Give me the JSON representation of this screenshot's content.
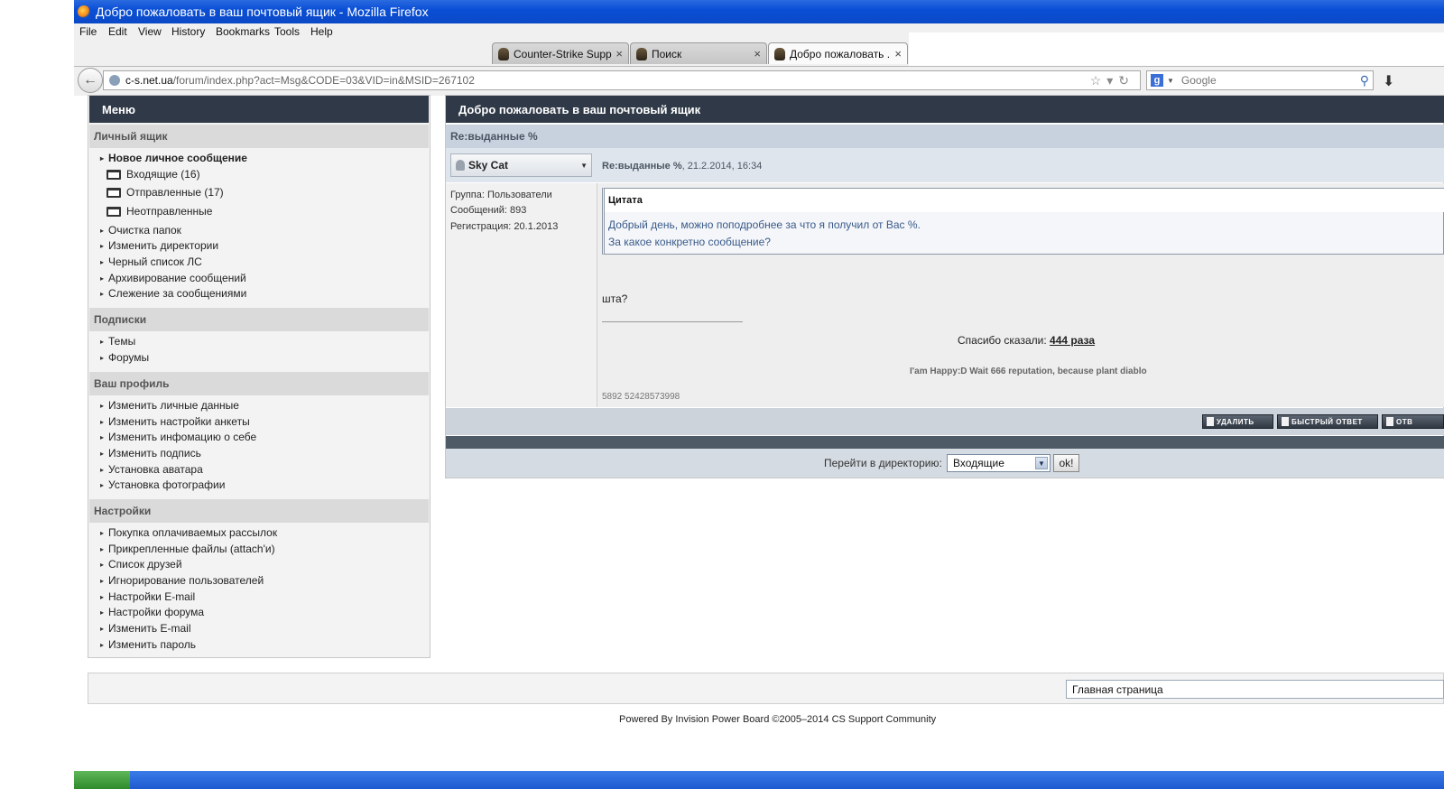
{
  "window": {
    "title": "Добро пожаловать в ваш почтовый ящик - Mozilla Firefox"
  },
  "menubar": [
    "File",
    "Edit",
    "View",
    "History",
    "Bookmarks",
    "Tools",
    "Help"
  ],
  "tabs": [
    {
      "label": "Counter-Strike Suppo...",
      "close": "×"
    },
    {
      "label": "Поиск",
      "close": "×"
    },
    {
      "label": "Добро пожаловать ...",
      "close": "×"
    }
  ],
  "navigation": {
    "back_glyph": "←",
    "url_host": "c-s.net.ua",
    "url_path": "/forum/index.php?act=Msg&CODE=03&VID=in&MSID=267102",
    "url_icons": "☆▾↻",
    "search_engine_glyph": "g",
    "search_placeholder": "Google",
    "search_button": "⚲",
    "download_glyph": "⬇"
  },
  "sidebar": {
    "title": "Меню",
    "sections": {
      "personal": "Личный ящик",
      "subscriptions": "Подписки",
      "profile": "Ваш профиль",
      "settings": "Настройки"
    },
    "new_message": "Новое личное сообщение",
    "folders": [
      "Входящие (16)",
      "Отправленные (17)",
      "Неотправленные"
    ],
    "personal_links": [
      "Очистка папок",
      "Изменить директории",
      "Черный список ЛС",
      "Архивирование сообщений",
      "Слежение за сообщениями"
    ],
    "subscription_links": [
      "Темы",
      "Форумы"
    ],
    "profile_links": [
      "Изменить личные данные",
      "Изменить настройки анкеты",
      "Изменить инфомацию о себе",
      "Изменить подпись",
      "Установка аватара",
      "Установка фотографии"
    ],
    "settings_links": [
      "Покупка оплачиваемых рассылок",
      "Прикрепленные файлы (attach'и)",
      "Список друзей",
      "Игнорирование пользователей",
      "Настройки E-mail",
      "Настройки форума",
      "Изменить E-mail",
      "Изменить пароль"
    ]
  },
  "main": {
    "title": "Добро пожаловать в ваш почтовый ящик",
    "subject": "Re:выданные %",
    "author": "Sky Cat",
    "post_subject": "Re:выданные %",
    "post_date": ", 21.2.2014, 16:34",
    "user_info": [
      "Группа: Пользователи",
      "Сообщений: 893",
      "Регистрация: 20.1.2013"
    ],
    "quote_title": "Цитата",
    "quote_lines": [
      "Добрый день, можно поподробнее за что я получил от Вас %.",
      "За какое конкретно сообщение?"
    ],
    "post_text": "шта?",
    "thanks_label": "Спасибо сказали: ",
    "thanks_link": "444 раза",
    "signature": "I'am Happy:D Wait 666 reputation, because plant diablo",
    "post_id": "5892 52428573998",
    "buttons": [
      "УДАЛИТЬ",
      "БЫСТРЫЙ ОТВЕТ",
      "ОТВ"
    ],
    "jump_label": "Перейти в директорию:",
    "jump_value": "Входящие",
    "jump_go": "ok!"
  },
  "footer": {
    "select_value": "Главная страница",
    "copyright": "Powered By Invision Power Board  ©2005–2014  CS Support Community"
  }
}
